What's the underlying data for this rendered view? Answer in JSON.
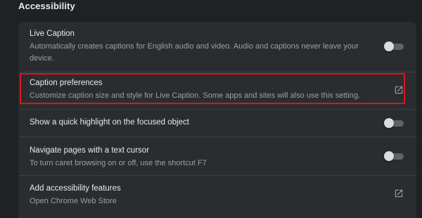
{
  "section": {
    "title": "Accessibility"
  },
  "settings": {
    "live_caption": {
      "title": "Live Caption",
      "description": "Automatically creates captions for English audio and video. Audio and captions never leave your device.",
      "toggle_on": false
    },
    "caption_preferences": {
      "title": "Caption preferences",
      "description": "Customize caption size and style for Live Caption. Some apps and sites will also use this setting.",
      "icon": "open-in-new-icon"
    },
    "focus_highlight": {
      "title": "Show a quick highlight on the focused object",
      "toggle_on": false
    },
    "caret_browsing": {
      "title": "Navigate pages with a text cursor",
      "description": "To turn caret browsing on or off, use the shortcut F7",
      "toggle_on": false
    },
    "add_features": {
      "title": "Add accessibility features",
      "description": "Open Chrome Web Store",
      "icon": "open-in-new-icon"
    }
  },
  "colors": {
    "background": "#202124",
    "card": "#2b2c2f",
    "primary_text": "#e8eaed",
    "secondary_text": "#9aa0a6",
    "highlight_border": "#d41920",
    "toggle_track": "#5f6368",
    "toggle_knob": "#dadce0"
  }
}
